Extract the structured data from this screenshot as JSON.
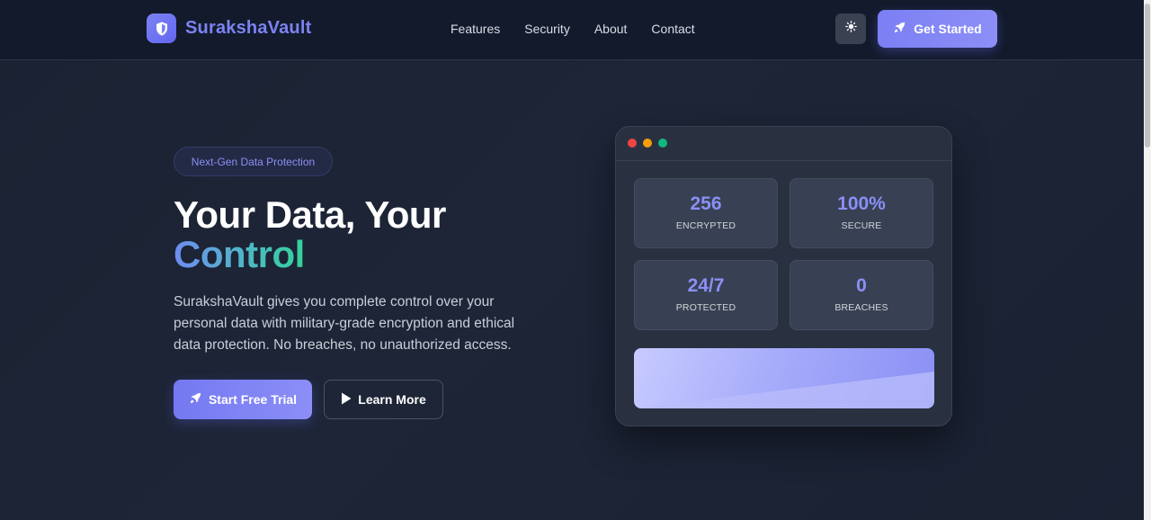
{
  "brand": {
    "name": "SurakshaVault"
  },
  "nav": {
    "items": [
      "Features",
      "Security",
      "About",
      "Contact"
    ]
  },
  "header": {
    "cta_label": "Get Started"
  },
  "hero": {
    "badge": "Next-Gen Data Protection",
    "title_line1": "Your Data, Your",
    "title_line2": "Control",
    "description": "SurakshaVault gives you complete control over your personal data with military-grade encryption and ethical data protection. No breaches, no unauthorized access.",
    "primary_button": "Start Free Trial",
    "secondary_button": "Learn More"
  },
  "mockup": {
    "stats": [
      {
        "value": "256",
        "label": "ENCRYPTED"
      },
      {
        "value": "100%",
        "label": "SECURE"
      },
      {
        "value": "24/7",
        "label": "PROTECTED"
      },
      {
        "value": "0",
        "label": "BREACHES"
      }
    ]
  },
  "icons": {
    "logo": "shield-icon",
    "theme_toggle": "sun-icon",
    "cta": "rocket-icon",
    "learn_more": "play-icon"
  },
  "colors": {
    "accent": "#7c83f2",
    "background": "#1b2232",
    "header": "#131a2b",
    "gradient_start": "#6f8cf0",
    "gradient_end": "#34d399"
  }
}
